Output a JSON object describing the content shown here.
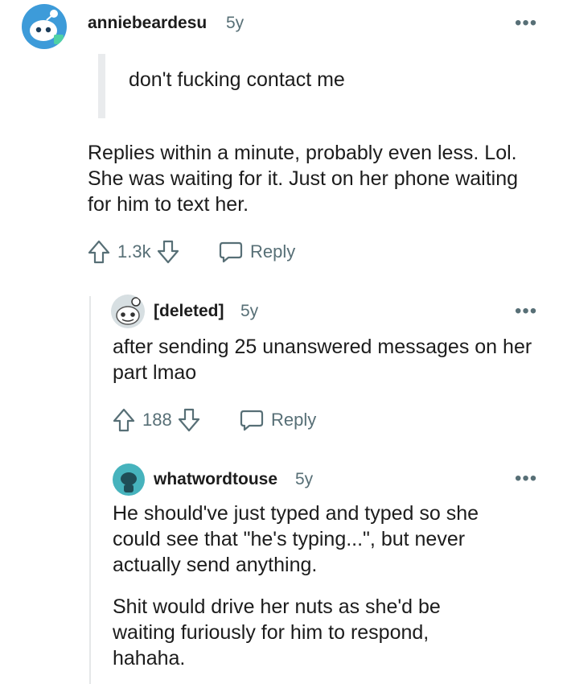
{
  "comments": [
    {
      "username": "anniebeardesu",
      "age": "5y",
      "quote": "don't fucking contact me",
      "paragraphs": [
        "Replies within a minute, probably even less. Lol. She was waiting for it. Just on her phone waiting for him to text her."
      ],
      "votes": "1.3k",
      "reply_label": "Reply",
      "more_label": "•••"
    },
    {
      "username": "[deleted]",
      "age": "5y",
      "paragraphs": [
        "after sending 25 unanswered messages on her part lmao"
      ],
      "votes": "188",
      "reply_label": "Reply",
      "more_label": "•••"
    },
    {
      "username": "whatwordtouse",
      "age": "5y",
      "paragraphs": [
        "He should've just typed and typed so she could see that \"he's typing...\", but never actually send anything.",
        "Shit would drive her nuts as she'd be waiting furiously for him to respond, hahaha."
      ],
      "more_label": "•••"
    }
  ],
  "colors": {
    "meta": "#576f76",
    "avatar_blue": "#3d9bd9",
    "avatar_teal": "#46b3bd"
  }
}
